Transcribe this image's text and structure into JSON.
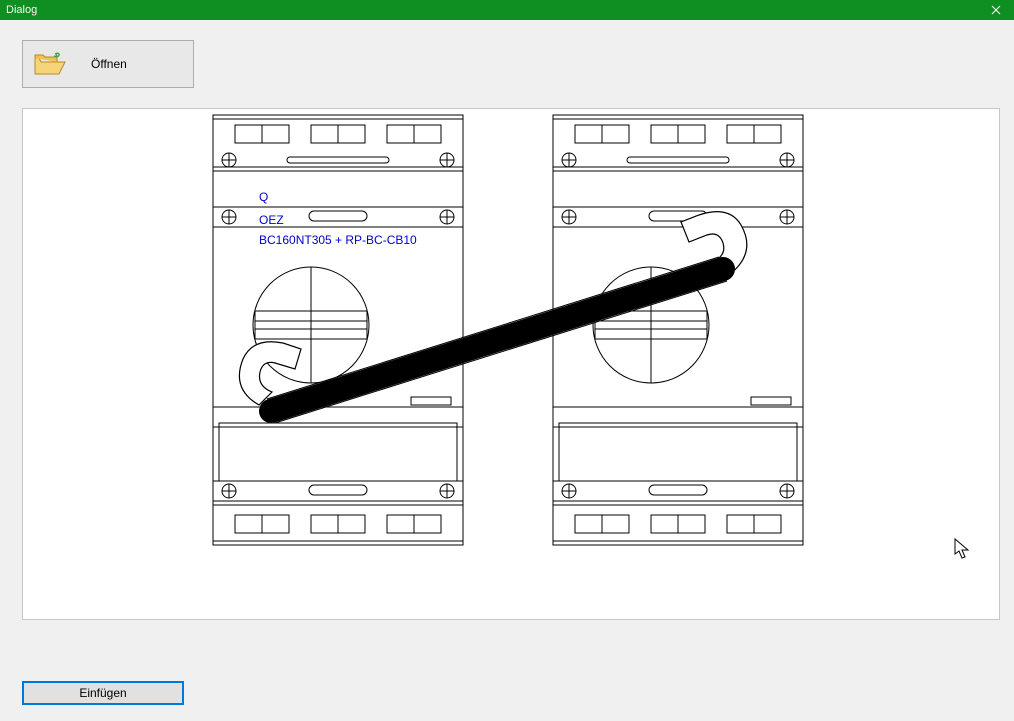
{
  "window": {
    "title": "Dialog"
  },
  "toolbar": {
    "open_label": "Öffnen"
  },
  "footer": {
    "insert_label": "Einfügen"
  },
  "preview": {
    "labels": {
      "left_q": "Q",
      "left_mfr": "OEZ",
      "left_part": "BC160NT305 + RP-BC-CB10"
    }
  },
  "colors": {
    "titlebar": "#0f8f22",
    "link_text": "#0000cc",
    "focus_ring": "#0078d7"
  }
}
